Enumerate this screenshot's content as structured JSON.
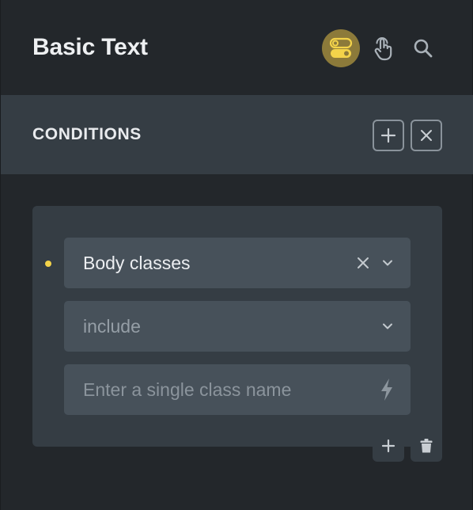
{
  "header": {
    "title": "Basic Text",
    "icons": [
      "toggle-icon",
      "hand-pointer-icon",
      "search-icon"
    ],
    "toggle_active_color": "#8c7a3a"
  },
  "conditions": {
    "title": "CONDITIONS",
    "actions": [
      "add-icon",
      "close-icon"
    ]
  },
  "condition": {
    "indicator_color": "#f3d34a",
    "key": {
      "value": "Body classes"
    },
    "compare": {
      "value": "include"
    },
    "input": {
      "placeholder": "Enter a single class name"
    },
    "footer_actions": [
      "add-icon",
      "trash-icon"
    ]
  }
}
